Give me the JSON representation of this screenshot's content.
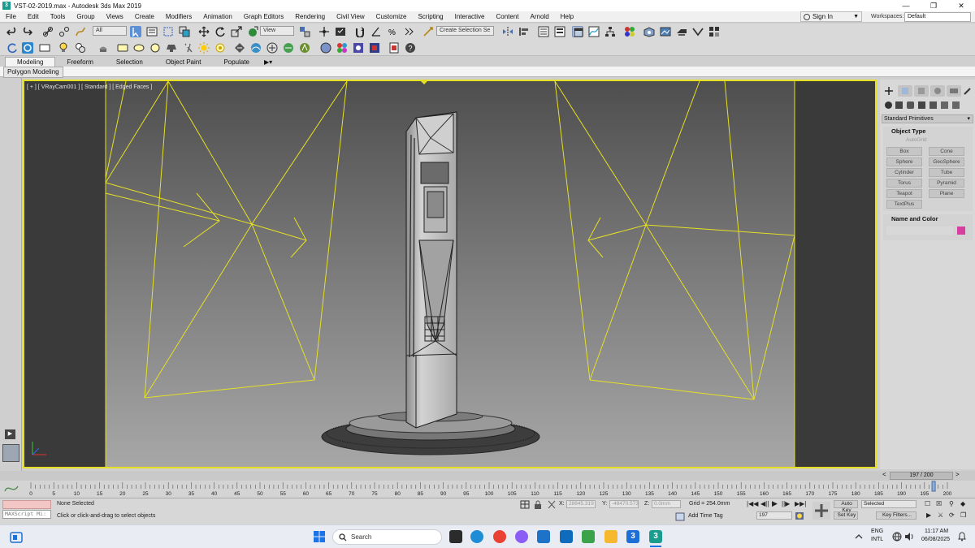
{
  "window": {
    "title": "VST-02-2019.max - Autodesk 3ds Max 2019",
    "app_icon": "3"
  },
  "menu": [
    "File",
    "Edit",
    "Tools",
    "Group",
    "Views",
    "Create",
    "Modifiers",
    "Animation",
    "Graph Editors",
    "Rendering",
    "Civil View",
    "Customize",
    "Scripting",
    "Interactive",
    "Content",
    "Arnold",
    "Help"
  ],
  "account": {
    "signin_label": "Sign In",
    "workspaces_label": "Workspaces:",
    "workspace_value": "Default"
  },
  "toolbar": {
    "filter_value": "All",
    "view_value": "View",
    "selection_set_placeholder": "Create Selection Se"
  },
  "ribbon": {
    "tabs": [
      "Modeling",
      "Freeform",
      "Selection",
      "Object Paint",
      "Populate"
    ],
    "active_tab": "Modeling",
    "polygon_modeling": "Polygon Modeling"
  },
  "viewport": {
    "label": "[ + ] [ VRayCam001 ] [ Standard ] [ Edged Faces ]",
    "wire_color": "#e6e024"
  },
  "command_panel": {
    "dropdown_value": "Standard Primitives",
    "object_type_header": "Object Type",
    "autogrid_label": "AutoGrid",
    "primitives": [
      "Box",
      "Cone",
      "Sphere",
      "GeoSphere",
      "Cylinder",
      "Tube",
      "Torus",
      "Pyramid",
      "Teapot",
      "Plane",
      "TextPlus"
    ],
    "name_color_header": "Name and Color",
    "object_color": "#d63fa0"
  },
  "timeline": {
    "frame_counter": "197 / 200",
    "ticks": [
      0,
      5,
      10,
      15,
      20,
      25,
      30,
      35,
      40,
      45,
      50,
      55,
      60,
      65,
      70,
      75,
      80,
      85,
      90,
      95,
      100,
      105,
      110,
      115,
      120,
      125,
      130,
      135,
      140,
      145,
      150,
      155,
      160,
      165,
      170,
      175,
      180,
      185,
      190,
      195,
      200
    ],
    "current_frame": 197,
    "total_frames": 200
  },
  "status": {
    "maxscript_label": "MAXScript Mi:",
    "selection_text": "None Selected",
    "prompt_text": "Click or click-and-drag to select objects",
    "x_label": "X:",
    "x_value": "28845.319",
    "y_label": "Y:",
    "y_value": "-48470.573",
    "z_label": "Z:",
    "z_value": "0.0mm",
    "grid_text": "Grid = 254.0mm",
    "add_time_tag": "Add Time Tag",
    "frame_value": "197",
    "auto_key": "Auto Key",
    "selected_value": "Selected",
    "set_key": "Set Key",
    "key_filters": "Key Filters..."
  },
  "taskbar": {
    "search_label": "Search",
    "lang_top": "ENG",
    "lang_bottom": "INTL",
    "time": "11:17 AM",
    "date": "06/08/2025"
  }
}
